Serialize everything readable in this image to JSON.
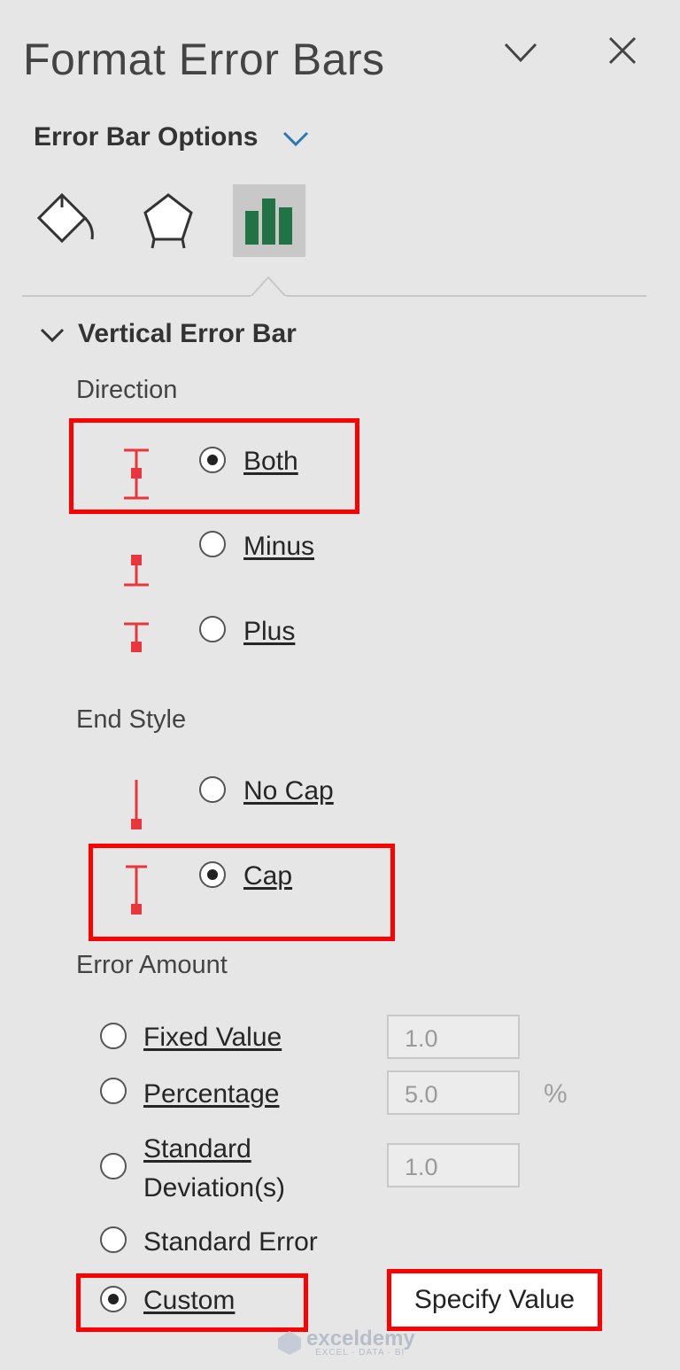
{
  "panel": {
    "title": "Format Error Bars",
    "options_label": "Error Bar Options"
  },
  "section": {
    "title": "Vertical Error Bar"
  },
  "direction": {
    "label": "Direction",
    "options": [
      {
        "label": "Both",
        "selected": true
      },
      {
        "label": "Minus",
        "selected": false
      },
      {
        "label": "Plus",
        "selected": false
      }
    ]
  },
  "end_style": {
    "label": "End Style",
    "options": [
      {
        "label": "No Cap",
        "selected": false
      },
      {
        "label": "Cap",
        "selected": true
      }
    ]
  },
  "error_amount": {
    "label": "Error Amount",
    "fixed_value": {
      "label": "Fixed Value",
      "value": "1.0"
    },
    "percentage": {
      "label": "Percentage",
      "value": "5.0",
      "unit": "%"
    },
    "std_dev": {
      "label_line1": "Standard",
      "label_line2": "Deviation(s)",
      "value": "1.0"
    },
    "std_error": {
      "label": "Standard Error"
    },
    "custom": {
      "label": "Custom",
      "selected": true
    },
    "specify_button": "Specify Value"
  },
  "watermark": {
    "text": "exceldemy",
    "sub": "EXCEL · DATA · BI"
  },
  "colors": {
    "accent_red": "#ff0000",
    "icon_red": "#e8363c",
    "chart_green": "#217346",
    "chevron_blue": "#2e75b6"
  }
}
